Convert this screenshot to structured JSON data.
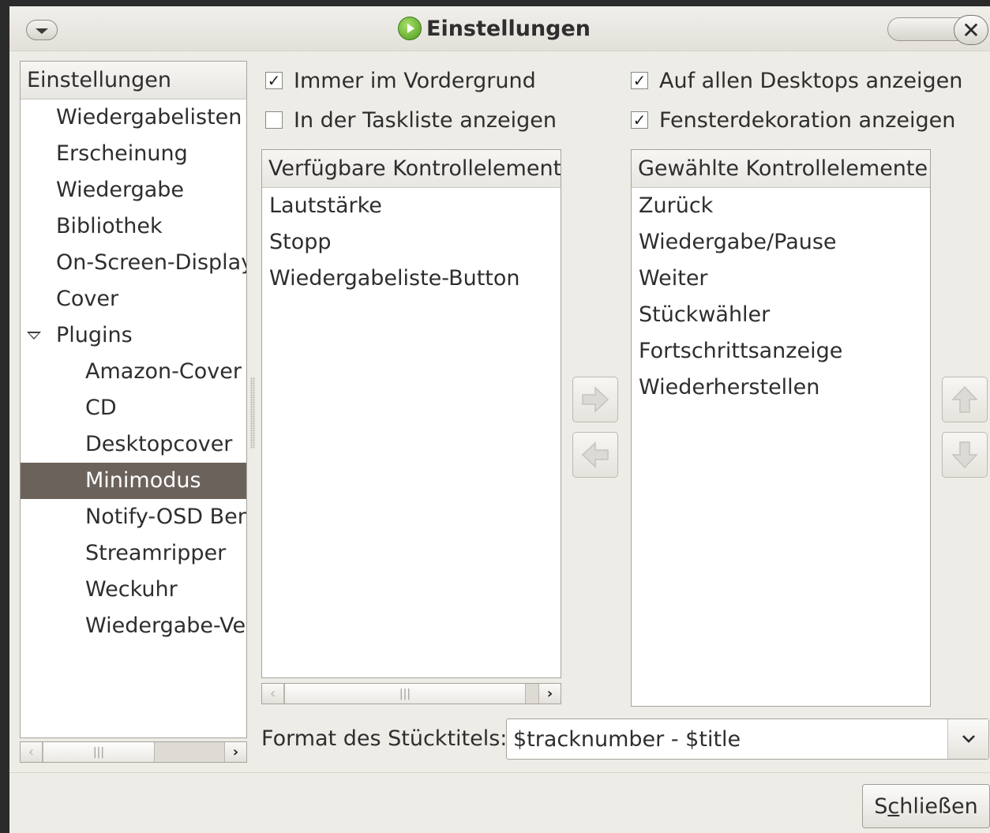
{
  "window": {
    "title": "Einstellungen"
  },
  "tree": {
    "header": "Einstellungen",
    "items": [
      {
        "label": "Wiedergabelisten",
        "level": 1
      },
      {
        "label": "Erscheinung",
        "level": 1
      },
      {
        "label": "Wiedergabe",
        "level": 1
      },
      {
        "label": "Bibliothek",
        "level": 1
      },
      {
        "label": "On-Screen-Display",
        "level": 1
      },
      {
        "label": "Cover",
        "level": 1
      },
      {
        "label": "Plugins",
        "level": 1,
        "expanded": true
      },
      {
        "label": "Amazon-Cover",
        "level": 2
      },
      {
        "label": "CD",
        "level": 2
      },
      {
        "label": "Desktopcover",
        "level": 2
      },
      {
        "label": "Minimodus",
        "level": 2,
        "selected": true
      },
      {
        "label": "Notify-OSD Ben",
        "level": 2
      },
      {
        "label": "Streamripper",
        "level": 2
      },
      {
        "label": "Weckuhr",
        "level": 2
      },
      {
        "label": "Wiedergabe-Ver",
        "level": 2
      }
    ]
  },
  "options": {
    "always_on_top": {
      "label": "Immer im Vordergrund",
      "checked": true
    },
    "show_in_tasklist": {
      "label": "In der Taskliste anzeigen",
      "checked": false
    },
    "all_desktops": {
      "label": "Auf allen Desktops anzeigen",
      "checked": true
    },
    "window_decoration": {
      "label": "Fensterdekoration anzeigen",
      "checked": true
    }
  },
  "available": {
    "header": "Verfügbare Kontrollelemente",
    "items": [
      "Lautstärke",
      "Stopp",
      "Wiedergabeliste-Button"
    ]
  },
  "selected": {
    "header": "Gewählte Kontrollelemente",
    "items": [
      "Zurück",
      "Wiedergabe/Pause",
      "Weiter",
      "Stückwähler",
      "Fortschrittsanzeige",
      "Wiederherstellen"
    ]
  },
  "format": {
    "label": "Format des Stücktitels:",
    "value": "$tracknumber - $title"
  },
  "buttons": {
    "close_prefix": "S",
    "close_mnemonic": "c",
    "close_suffix": "hließen"
  },
  "icons": {
    "check": "✓",
    "scroll_left": "‹",
    "scroll_right": "›",
    "thumb_grip": "|||",
    "close": "✕"
  },
  "colors": {
    "selection": "#6b625c",
    "window_bg": "#eeece7",
    "app_icon": "#4c9a1c"
  }
}
